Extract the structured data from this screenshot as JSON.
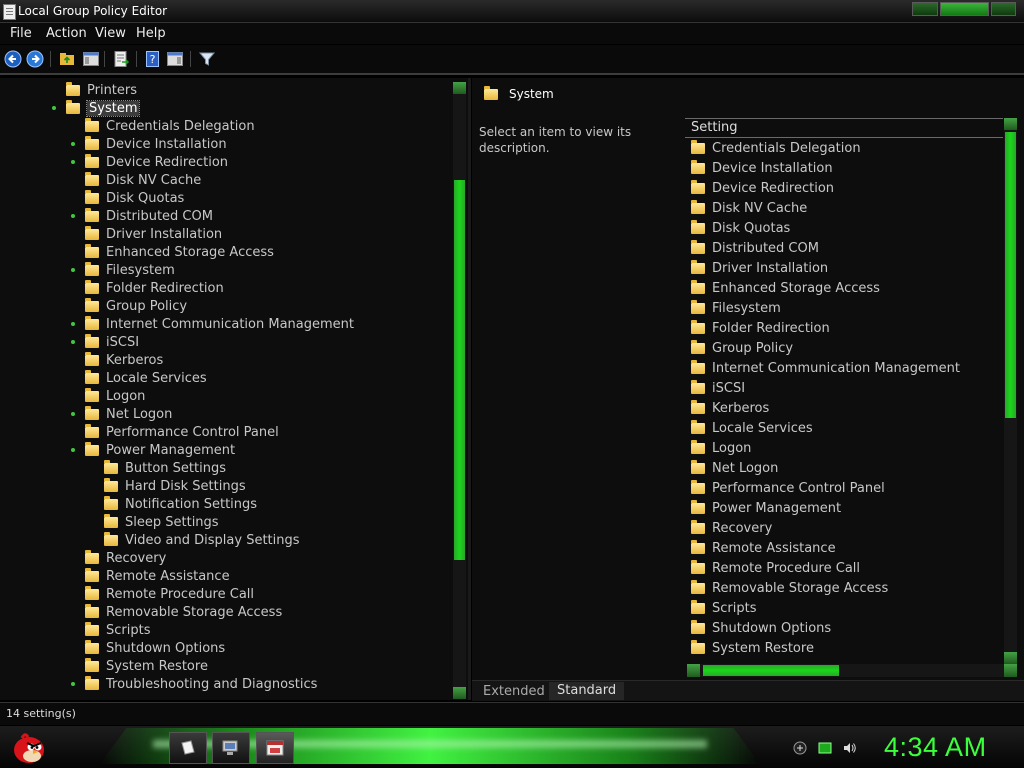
{
  "window": {
    "title": "Local Group Policy Editor"
  },
  "menu": {
    "items": [
      "File",
      "Action",
      "View",
      "Help"
    ]
  },
  "toolbar": {
    "buttons": [
      "back-arrow-icon",
      "forward-arrow-icon",
      "up-folder-icon",
      "show-hide-console-tree-icon",
      "export-list-icon",
      "help-icon",
      "action-pane-icon",
      "filter-icon"
    ]
  },
  "tree": {
    "items": [
      {
        "label": "Printers",
        "level": 1,
        "bullet": false
      },
      {
        "label": "System",
        "level": 1,
        "bullet": true,
        "selected": true
      },
      {
        "label": "Credentials Delegation",
        "level": 2,
        "bullet": false
      },
      {
        "label": "Device Installation",
        "level": 2,
        "bullet": true
      },
      {
        "label": "Device Redirection",
        "level": 2,
        "bullet": true
      },
      {
        "label": "Disk NV Cache",
        "level": 2,
        "bullet": false
      },
      {
        "label": "Disk Quotas",
        "level": 2,
        "bullet": false
      },
      {
        "label": "Distributed COM",
        "level": 2,
        "bullet": true
      },
      {
        "label": "Driver Installation",
        "level": 2,
        "bullet": false
      },
      {
        "label": "Enhanced Storage Access",
        "level": 2,
        "bullet": false
      },
      {
        "label": "Filesystem",
        "level": 2,
        "bullet": true
      },
      {
        "label": "Folder Redirection",
        "level": 2,
        "bullet": false
      },
      {
        "label": "Group Policy",
        "level": 2,
        "bullet": false
      },
      {
        "label": "Internet Communication Management",
        "level": 2,
        "bullet": true
      },
      {
        "label": "iSCSI",
        "level": 2,
        "bullet": true
      },
      {
        "label": "Kerberos",
        "level": 2,
        "bullet": false
      },
      {
        "label": "Locale Services",
        "level": 2,
        "bullet": false
      },
      {
        "label": "Logon",
        "level": 2,
        "bullet": false
      },
      {
        "label": "Net Logon",
        "level": 2,
        "bullet": true
      },
      {
        "label": "Performance Control Panel",
        "level": 2,
        "bullet": false
      },
      {
        "label": "Power Management",
        "level": 2,
        "bullet": true
      },
      {
        "label": "Button Settings",
        "level": 3,
        "bullet": false
      },
      {
        "label": "Hard Disk Settings",
        "level": 3,
        "bullet": false
      },
      {
        "label": "Notification Settings",
        "level": 3,
        "bullet": false
      },
      {
        "label": "Sleep Settings",
        "level": 3,
        "bullet": false
      },
      {
        "label": "Video and Display Settings",
        "level": 3,
        "bullet": false
      },
      {
        "label": "Recovery",
        "level": 2,
        "bullet": false
      },
      {
        "label": "Remote Assistance",
        "level": 2,
        "bullet": false
      },
      {
        "label": "Remote Procedure Call",
        "level": 2,
        "bullet": false
      },
      {
        "label": "Removable Storage Access",
        "level": 2,
        "bullet": false
      },
      {
        "label": "Scripts",
        "level": 2,
        "bullet": false
      },
      {
        "label": "Shutdown Options",
        "level": 2,
        "bullet": false
      },
      {
        "label": "System Restore",
        "level": 2,
        "bullet": false
      },
      {
        "label": "Troubleshooting and Diagnostics",
        "level": 2,
        "bullet": true
      }
    ]
  },
  "details": {
    "title": "System",
    "description": "Select an item to view its description.",
    "column_header": "Setting",
    "settings": [
      "Credentials Delegation",
      "Device Installation",
      "Device Redirection",
      "Disk NV Cache",
      "Disk Quotas",
      "Distributed COM",
      "Driver Installation",
      "Enhanced Storage Access",
      "Filesystem",
      "Folder Redirection",
      "Group Policy",
      "Internet Communication Management",
      "iSCSI",
      "Kerberos",
      "Locale Services",
      "Logon",
      "Net Logon",
      "Performance Control Panel",
      "Power Management",
      "Recovery",
      "Remote Assistance",
      "Remote Procedure Call",
      "Removable Storage Access",
      "Scripts",
      "Shutdown Options",
      "System Restore"
    ],
    "tabs": [
      "Extended",
      "Standard"
    ],
    "active_tab": "Standard"
  },
  "status": {
    "text": "14 setting(s)"
  },
  "taskbar": {
    "clock": "4:34 AM",
    "apps": [
      "notes-app-icon",
      "computer-app-icon",
      "group-policy-app-icon"
    ],
    "tray": [
      "network-tray-icon",
      "battery-tray-icon",
      "volume-tray-icon"
    ]
  },
  "colors": {
    "accent": "#3cff3c",
    "background": "#0d0d0d",
    "text": "#c8c8c8"
  }
}
